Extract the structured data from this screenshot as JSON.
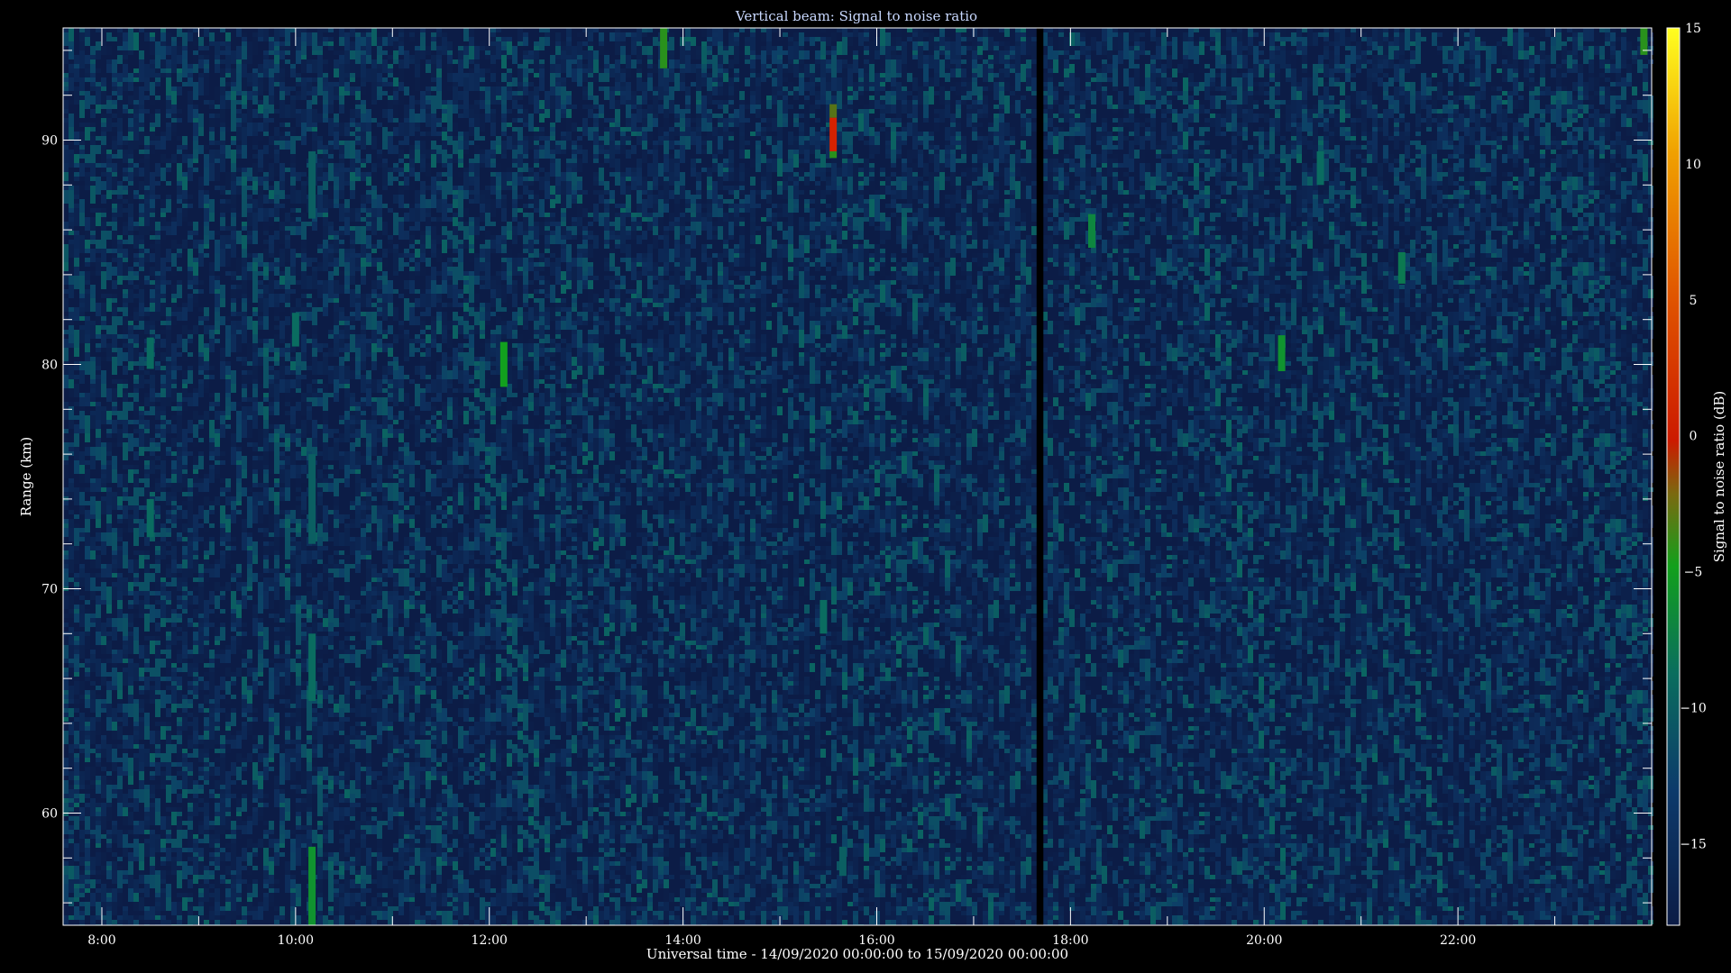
{
  "chart_data": {
    "type": "heatmap",
    "title": "Vertical beam: Signal to noise ratio",
    "xlabel": "Universal time - 14/09/2020 00:00:00 to 15/09/2020 00:00:00",
    "ylabel": "Range (km)",
    "colorbar_label": "Signal to noise ratio (dB)",
    "x_range_hours": [
      7.6,
      24.0
    ],
    "y_range_km": [
      55.0,
      95.0
    ],
    "colorbar_range_db": [
      -18.0,
      15.0
    ],
    "x_ticks": [
      {
        "value": 8,
        "label": "8:00"
      },
      {
        "value": 10,
        "label": "10:00"
      },
      {
        "value": 12,
        "label": "12:00"
      },
      {
        "value": 14,
        "label": "14:00"
      },
      {
        "value": 16,
        "label": "16:00"
      },
      {
        "value": 18,
        "label": "18:00"
      },
      {
        "value": 20,
        "label": "20:00"
      },
      {
        "value": 22,
        "label": "22:00"
      }
    ],
    "y_ticks": [
      {
        "value": 60,
        "label": "60"
      },
      {
        "value": 70,
        "label": "70"
      },
      {
        "value": 80,
        "label": "80"
      },
      {
        "value": 90,
        "label": "90"
      }
    ],
    "colorbar_ticks": [
      {
        "value": 15,
        "label": "15"
      },
      {
        "value": 10,
        "label": "10"
      },
      {
        "value": 5,
        "label": "5"
      },
      {
        "value": 0,
        "label": "0"
      },
      {
        "value": -5,
        "label": "−5"
      },
      {
        "value": -10,
        "label": "−10"
      },
      {
        "value": -15,
        "label": "−15"
      }
    ],
    "background_level_db": -16,
    "data_gap_hours": [
      17.65,
      17.72
    ],
    "features": [
      {
        "time": 10.17,
        "range_start": 55.0,
        "range_end": 58.5,
        "snr": -8
      },
      {
        "time": 10.17,
        "range_start": 65.0,
        "range_end": 68.0,
        "snr": -11
      },
      {
        "time": 10.17,
        "range_start": 72.0,
        "range_end": 76.0,
        "snr": -12
      },
      {
        "time": 10.17,
        "range_start": 86.5,
        "range_end": 89.5,
        "snr": -12
      },
      {
        "time": 13.8,
        "range_start": 93.2,
        "range_end": 95.0,
        "snr": -6
      },
      {
        "time": 15.55,
        "range_start": 89.5,
        "range_end": 91.0,
        "snr": 1
      },
      {
        "time": 15.55,
        "range_start": 89.2,
        "range_end": 89.5,
        "snr": -6
      },
      {
        "time": 15.55,
        "range_start": 91.0,
        "range_end": 91.6,
        "snr": -4
      },
      {
        "time": 12.15,
        "range_start": 79.0,
        "range_end": 81.0,
        "snr": -7
      },
      {
        "time": 18.22,
        "range_start": 85.2,
        "range_end": 86.7,
        "snr": -9
      },
      {
        "time": 20.18,
        "range_start": 79.7,
        "range_end": 81.3,
        "snr": -8
      },
      {
        "time": 21.42,
        "range_start": 83.6,
        "range_end": 85.0,
        "snr": -10
      },
      {
        "time": 23.92,
        "range_start": 93.8,
        "range_end": 95.0,
        "snr": -6
      },
      {
        "time": 10.0,
        "range_start": 80.8,
        "range_end": 82.3,
        "snr": -11
      },
      {
        "time": 8.5,
        "range_start": 79.8,
        "range_end": 81.2,
        "snr": -11
      },
      {
        "time": 8.5,
        "range_start": 72.3,
        "range_end": 74.0,
        "snr": -11
      },
      {
        "time": 20.58,
        "range_start": 88.0,
        "range_end": 89.5,
        "snr": -11
      },
      {
        "time": 15.45,
        "range_start": 68.0,
        "range_end": 69.5,
        "snr": -11
      },
      {
        "time": 15.65,
        "range_start": 57.2,
        "range_end": 58.5,
        "snr": -12
      }
    ]
  }
}
